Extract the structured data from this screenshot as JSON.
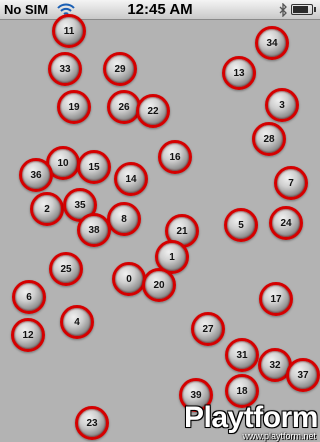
{
  "status_bar": {
    "carrier": "No SIM",
    "time": "12:45 AM",
    "wifi_icon": "wifi-icon",
    "bluetooth_icon": "bluetooth-icon",
    "battery_icon": "battery-icon",
    "battery_level": 0.9
  },
  "balls": [
    {
      "label": "11"
    },
    {
      "label": "34"
    },
    {
      "label": "33"
    },
    {
      "label": "29"
    },
    {
      "label": "13"
    },
    {
      "label": "19"
    },
    {
      "label": "26"
    },
    {
      "label": "22"
    },
    {
      "label": "3"
    },
    {
      "label": "28"
    },
    {
      "label": "16"
    },
    {
      "label": "10"
    },
    {
      "label": "15"
    },
    {
      "label": "36"
    },
    {
      "label": "14"
    },
    {
      "label": "7"
    },
    {
      "label": "2"
    },
    {
      "label": "35"
    },
    {
      "label": "8"
    },
    {
      "label": "38"
    },
    {
      "label": "21"
    },
    {
      "label": "5"
    },
    {
      "label": "24"
    },
    {
      "label": "1"
    },
    {
      "label": "25"
    },
    {
      "label": "0"
    },
    {
      "label": "20"
    },
    {
      "label": "6"
    },
    {
      "label": "17"
    },
    {
      "label": "4"
    },
    {
      "label": "12"
    },
    {
      "label": "27"
    },
    {
      "label": "31"
    },
    {
      "label": "32"
    },
    {
      "label": "37"
    },
    {
      "label": "39"
    },
    {
      "label": "18"
    },
    {
      "label": "23"
    }
  ],
  "watermark": {
    "brand": "Playtform",
    "url": "www.playtform.net"
  },
  "colors": {
    "background": "#b3b3b3",
    "ball_ring": "#d40000"
  }
}
